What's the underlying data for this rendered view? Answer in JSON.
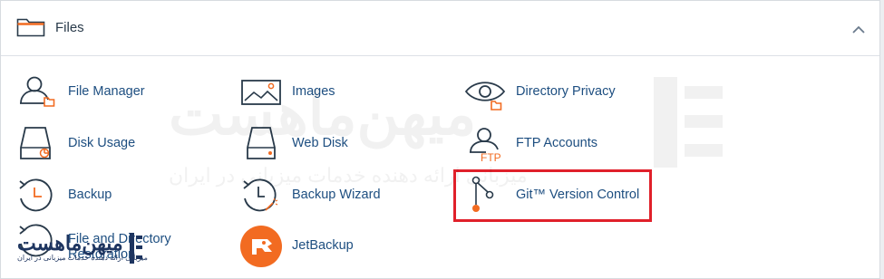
{
  "section": {
    "title": "Files",
    "icon": "folder-icon",
    "collapse_icon": "chevron-up-icon"
  },
  "items": [
    {
      "label": "File Manager",
      "icon": "file-manager-icon"
    },
    {
      "label": "Images",
      "icon": "images-icon"
    },
    {
      "label": "Directory Privacy",
      "icon": "directory-privacy-icon"
    },
    {
      "label": "Disk Usage",
      "icon": "disk-usage-icon"
    },
    {
      "label": "Web Disk",
      "icon": "web-disk-icon"
    },
    {
      "label": "FTP Accounts",
      "icon": "ftp-accounts-icon"
    },
    {
      "label": "Backup",
      "icon": "backup-icon"
    },
    {
      "label": "Backup Wizard",
      "icon": "backup-wizard-icon"
    },
    {
      "label": "Git™ Version Control",
      "icon": "git-icon"
    },
    {
      "label": "File and Directory Restoration",
      "icon": "file-restoration-icon"
    },
    {
      "label": "JetBackup",
      "icon": "jetbackup-icon"
    }
  ],
  "ftp_badge": "FTP",
  "watermark": {
    "text": "میهن‌ماهست",
    "subtitle": "میزبانی ارائه دهنده خدمات میزبانی در ایران"
  },
  "colors": {
    "link": "#1d4e80",
    "accent_orange": "#f26b21",
    "highlight": "#e0202a"
  }
}
